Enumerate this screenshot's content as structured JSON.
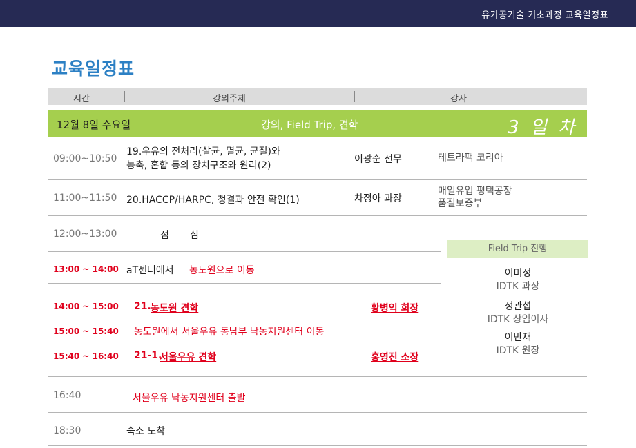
{
  "header": {
    "title": "유가공기술 기초과정 교육일정표"
  },
  "page_title": "교육일정표",
  "columns": [
    "시간",
    "강의주제",
    "강사"
  ],
  "day": {
    "date": "12월 8일 수요일",
    "topic": "강의, Field Trip, 견학",
    "nth": "3 일 차"
  },
  "rows": {
    "r1": {
      "time": "09:00~10:50",
      "topic_line1": "19.우유의 전처리(살균, 멸균, 균질)와",
      "topic_line2": "농축, 혼합 등의 장치구조와 원리(2)",
      "lecturer": "이광순 전무",
      "company": "테트라팩 코리아"
    },
    "r2": {
      "time": "11:00~11:50",
      "topic": "20.HACCP/HARPC, 청결과 안전 확인(1)",
      "lecturer": "차정아 과장",
      "company_line1": "매일유업 평택공장",
      "company_line2": "품질보증부"
    },
    "r3": {
      "time": "12:00~13:00",
      "lunch1": "점",
      "lunch2": "심"
    },
    "r4": {
      "time": "13:00 ~ 14:00",
      "prefix": "aT센터에서",
      "move": "농도원으로 이동"
    },
    "r5": {
      "time": "14:00 ~ 15:00",
      "num": "21.",
      "topic": "농도원 견학",
      "host": "황병익 회장"
    },
    "r6": {
      "time": "15:00 ~ 15:40",
      "move": "농도원에서 서울우유 동남부 낙농지원센터 이동"
    },
    "r7": {
      "time": "15:40 ~ 16:40",
      "num": "21-1.",
      "topic": "서울우유 견학",
      "host": "홍영진 소장"
    },
    "r8": {
      "time": "16:40",
      "text": "서울우유 낙농지원센터 출발"
    },
    "r9": {
      "time": "18:30",
      "text": "숙소 도착"
    }
  },
  "field_trip": {
    "label": "Field Trip 진행",
    "guides": [
      {
        "name": "이미정",
        "role": "IDTK 과장"
      },
      {
        "name": "정관섭",
        "role": "IDTK 상임이사"
      },
      {
        "name": "이만재",
        "role": "IDTK 원장"
      }
    ]
  },
  "colors": {
    "topbar": "#262a54",
    "title_blue": "#2c80c4",
    "day_band": "#a5cf4e",
    "field_trip_box": "#ddeec4",
    "red": "#e0001c"
  }
}
